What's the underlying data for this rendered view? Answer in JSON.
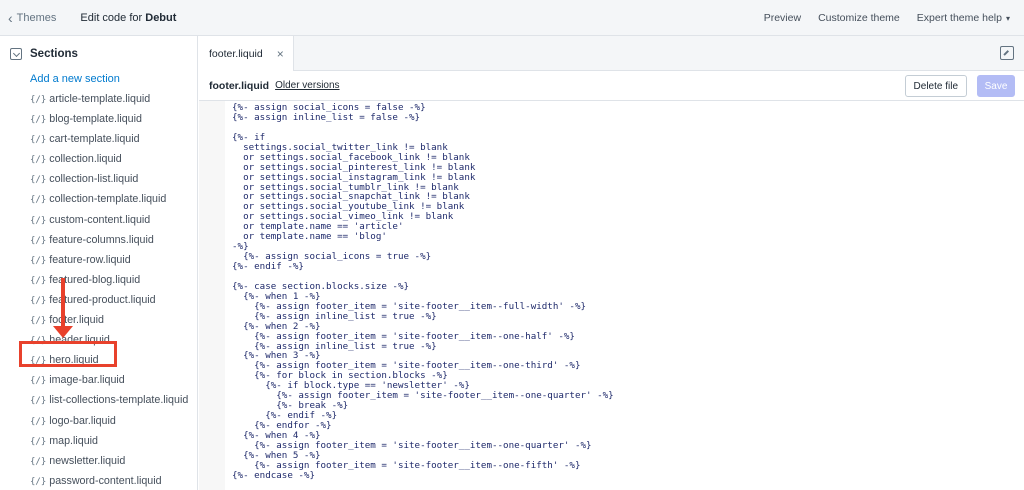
{
  "topbar": {
    "back_label": "Themes",
    "title_prefix": "Edit code for ",
    "title_theme": "Debut",
    "preview": "Preview",
    "customize": "Customize theme",
    "expert_help": "Expert theme help"
  },
  "sidebar": {
    "section_title": "Sections",
    "add_link": "Add a new section",
    "file_icon": "{/}",
    "files": [
      "article-template.liquid",
      "blog-template.liquid",
      "cart-template.liquid",
      "collection.liquid",
      "collection-list.liquid",
      "collection-template.liquid",
      "custom-content.liquid",
      "feature-columns.liquid",
      "feature-row.liquid",
      "featured-blog.liquid",
      "featured-product.liquid",
      "footer.liquid",
      "header.liquid",
      "hero.liquid",
      "image-bar.liquid",
      "list-collections-template.liquid",
      "logo-bar.liquid",
      "map.liquid",
      "newsletter.liquid",
      "password-content.liquid"
    ]
  },
  "editor": {
    "tab_label": "footer.liquid",
    "file_name": "footer.liquid",
    "older_versions": "Older versions",
    "delete_label": "Delete file",
    "save_label": "Save",
    "lines": [
      "{%- assign social_icons = false -%}",
      "{%- assign inline_list = false -%}",
      "",
      "{%- if",
      "  settings.social_twitter_link != blank",
      "  or settings.social_facebook_link != blank",
      "  or settings.social_pinterest_link != blank",
      "  or settings.social_instagram_link != blank",
      "  or settings.social_tumblr_link != blank",
      "  or settings.social_snapchat_link != blank",
      "  or settings.social_youtube_link != blank",
      "  or settings.social_vimeo_link != blank",
      "  or template.name == 'article'",
      "  or template.name == 'blog'",
      "-%}",
      "  {%- assign social_icons = true -%}",
      "{%- endif -%}",
      "",
      "{%- case section.blocks.size -%}",
      "  {%- when 1 -%}",
      "    {%- assign footer_item = 'site-footer__item--full-width' -%}",
      "    {%- assign inline_list = true -%}",
      "  {%- when 2 -%}",
      "    {%- assign footer_item = 'site-footer__item--one-half' -%}",
      "    {%- assign inline_list = true -%}",
      "  {%- when 3 -%}",
      "    {%- assign footer_item = 'site-footer__item--one-third' -%}",
      "    {%- for block in section.blocks -%}",
      "      {%- if block.type == 'newsletter' -%}",
      "        {%- assign footer_item = 'site-footer__item--one-quarter' -%}",
      "        {%- break -%}",
      "      {%- endif -%}",
      "    {%- endfor -%}",
      "  {%- when 4 -%}",
      "    {%- assign footer_item = 'site-footer__item--one-quarter' -%}",
      "  {%- when 5 -%}",
      "    {%- assign footer_item = 'site-footer__item--one-fifth' -%}",
      "{%- endcase -%}"
    ]
  }
}
